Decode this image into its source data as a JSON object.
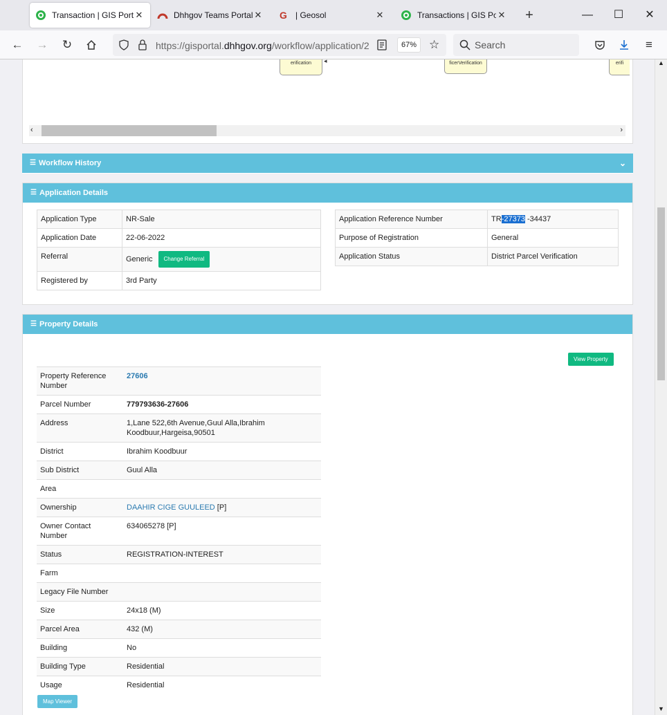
{
  "browser": {
    "tabs": [
      {
        "label": "Transaction | GIS Portal",
        "active": true
      },
      {
        "label": "Dhhgov Teams Portal",
        "active": false
      },
      {
        "label": "| Geosol",
        "active": false
      },
      {
        "label": "Transactions | GIS Portal",
        "active": false
      }
    ],
    "url_prefix": "https://gisportal.",
    "url_domain": "dhhgov.org",
    "url_path": "/workflow/application/2",
    "zoom": "67%",
    "search_placeholder": "Search"
  },
  "workflow_nodes": [
    "erification",
    "ficerVerification",
    "erifi"
  ],
  "workflow_history": {
    "title": "Workflow History"
  },
  "application_details": {
    "title": "Application Details",
    "left": [
      {
        "label": "Application Type",
        "value": "NR-Sale"
      },
      {
        "label": "Application Date",
        "value": "22-06-2022"
      },
      {
        "label": "Referral",
        "value": "Generic"
      },
      {
        "label": "Registered by",
        "value": "3rd Party"
      }
    ],
    "change_referral_label": "Change Referral",
    "right": [
      {
        "label": "Application Reference Number",
        "value_prefix": "TR",
        "value_highlight": "-27373",
        "value_suffix": " -34437"
      },
      {
        "label": "Purpose of Registration",
        "value": "General"
      },
      {
        "label": "Application Status",
        "value": "District Parcel Verification"
      }
    ]
  },
  "property_details": {
    "title": "Property Details",
    "view_property_label": "View Property",
    "map_viewer_label": "Map Viewer",
    "rows": [
      {
        "label": "Property Reference Number",
        "value": "27606"
      },
      {
        "label": "Parcel Number",
        "value": "779793636-27606"
      },
      {
        "label": "Address",
        "value": "1,Lane 522,6th Avenue,Guul Alla,Ibrahim Koodbuur,Hargeisa,90501"
      },
      {
        "label": "District",
        "value": "Ibrahim Koodbuur"
      },
      {
        "label": "Sub District",
        "value": "Guul Alla"
      },
      {
        "label": "Area",
        "value": ""
      },
      {
        "label": "Ownership",
        "value": "DAAHIR CIGE GUULEED",
        "suffix": " [P]"
      },
      {
        "label": "Owner Contact Number",
        "value": "634065278 [P]"
      },
      {
        "label": "Status",
        "value": "REGISTRATION-INTEREST"
      },
      {
        "label": "Farm",
        "value": ""
      },
      {
        "label": "Legacy File Number",
        "value": ""
      },
      {
        "label": "Size",
        "value": "24x18 (M)"
      },
      {
        "label": "Parcel Area",
        "value": "432 (M)"
      },
      {
        "label": "Building",
        "value": "No"
      },
      {
        "label": "Building Type",
        "value": "Residential"
      },
      {
        "label": "Usage",
        "value": "Residential"
      }
    ]
  }
}
